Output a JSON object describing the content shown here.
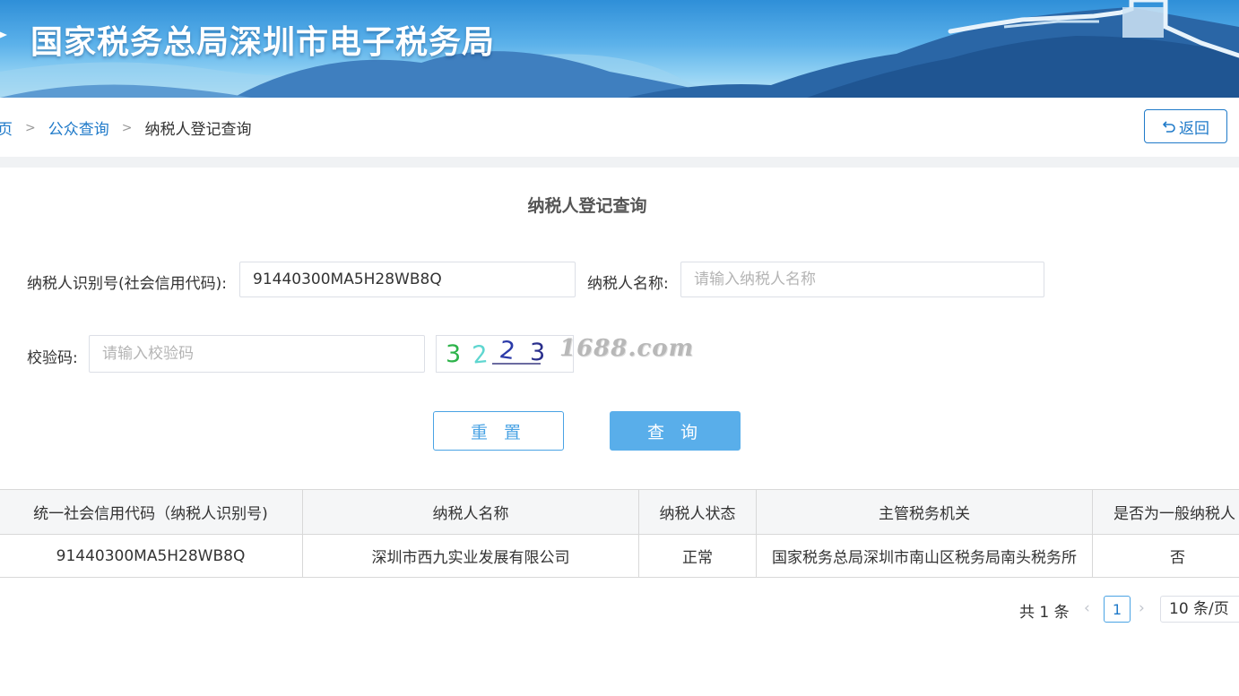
{
  "header": {
    "title": "国家税务总局深圳市电子税务局"
  },
  "breadcrumb": {
    "home": "页",
    "public_query": "公众查询",
    "current": "纳税人登记查询"
  },
  "back_button": {
    "label": "返回"
  },
  "form": {
    "title": "纳税人登记查询",
    "taxpayer_id_label": "纳税人识别号(社会信用代码):",
    "taxpayer_id_value": "91440300MA5H28WB8Q",
    "taxpayer_name_label": "纳税人名称:",
    "taxpayer_name_placeholder": "请输入纳税人名称",
    "captcha_label": "校验码:",
    "captcha_placeholder": "请输入校验码",
    "captcha_chars": [
      "3",
      "2",
      "2",
      "3"
    ],
    "watermark": "1688.com",
    "reset_label": "重 置",
    "query_label": "查 询"
  },
  "table": {
    "headers": [
      "统一社会信用代码（纳税人识别号)",
      "纳税人名称",
      "纳税人状态",
      "主管税务机关",
      "是否为一般纳税人"
    ],
    "rows": [
      [
        "91440300MA5H28WB8Q",
        "深圳市西九实业发展有限公司",
        "正常",
        "国家税务总局深圳市南山区税务局南头税务所",
        "否"
      ]
    ]
  },
  "pagination": {
    "total": "共 1 条",
    "current_page": "1",
    "page_size": "10 条/页"
  },
  "colors": {
    "accent": "#1f7ac9",
    "button_primary": "#59aeea",
    "banner_top": "#2f8fd8"
  }
}
